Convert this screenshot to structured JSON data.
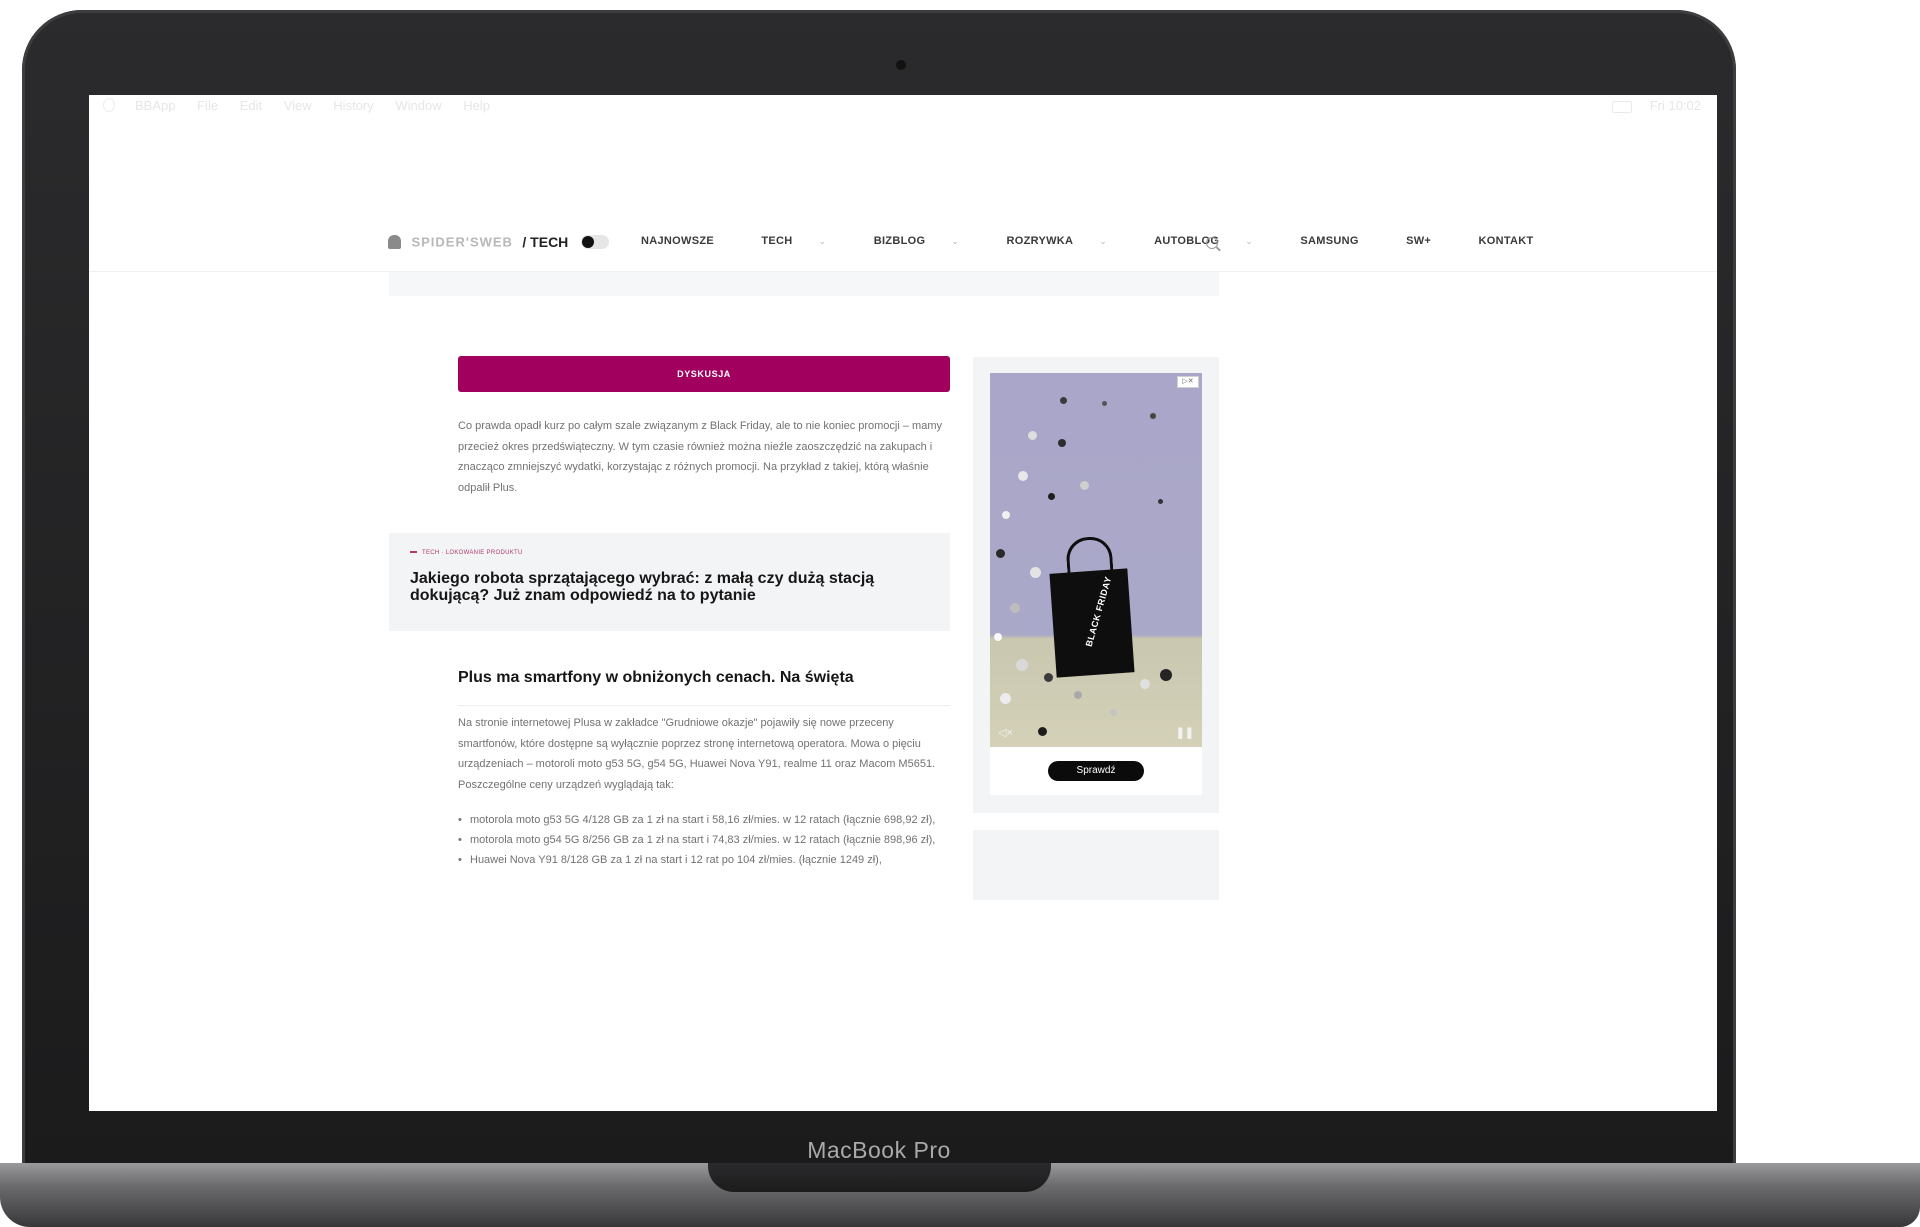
{
  "device": {
    "model_label": "MacBook Pro"
  },
  "menubar": {
    "items": [
      "BBApp",
      "File",
      "Edit",
      "View",
      "History",
      "Window",
      "Help"
    ],
    "clock": "Fri 10:02"
  },
  "site": {
    "logo_text": "SPIDER'SWEB",
    "section": "/ TECH",
    "nav": [
      {
        "label": "NAJNOWSZE",
        "caret": ""
      },
      {
        "label": "TECH",
        "caret": "⌄"
      },
      {
        "label": "BIZBLOG",
        "caret": "⌄"
      },
      {
        "label": "ROZRYWKA",
        "caret": "⌄"
      },
      {
        "label": "AUTOBLOG",
        "caret": "⌄"
      },
      {
        "label": "SAMSUNG",
        "caret": ""
      },
      {
        "label": "SW+",
        "caret": ""
      },
      {
        "label": "KONTAKT",
        "caret": ""
      }
    ]
  },
  "article": {
    "discuss_label": "DYSKUSJA",
    "intro": "Co prawda opadł kurz po całym szale związanym z Black Friday, ale to nie koniec promocji – mamy przecież okres przedświąteczny. W tym czasie również można nieźle zaoszczędzić na zakupach i znacząco zmniejszyć wydatki, korzystając z różnych promocji. Na przykład z takiej, którą właśnie odpalił Plus.",
    "related": {
      "category": "TECH · LOKOWANIE PRODUKTU",
      "title": "Jakiego robota sprzątającego wybrać: z małą czy dużą stacją dokującą? Już znam odpowiedź na to pytanie"
    },
    "heading": "Plus ma smartfony w obniżonych cenach. Na święta",
    "body": "Na stronie internetowej Plusa w zakładce \"Grudniowe okazje\" pojawiły się nowe przeceny smartfonów, które dostępne są wyłącznie poprzez stronę internetową operatora. Mowa o pięciu urządzeniach – motoroli moto g53 5G, g54 5G, Huawei Nova Y91, realme 11 oraz Macom M5651. Poszczególne ceny urządzeń wyglądają tak:",
    "bullets": [
      "motorola moto g53 5G 4/128 GB za 1 zł na start i 58,16 zł/mies. w 12 ratach (łącznie 698,92 zł),",
      "motorola moto g54 5G 8/256 GB za 1 zł na start i 74,83 zł/mies. w 12 ratach (łącznie 898,96 zł),",
      "Huawei Nova Y91 8/128 GB za 1 zł na start i 12 rat po 104 zł/mies. (łącznie 1249 zł),"
    ]
  },
  "ad": {
    "badge": "▷✕",
    "bag_text": "BLACK FRIDAY",
    "cta_label": "Sprawdź",
    "mute_icon": "speaker-muted-icon",
    "pause_icon": "pause-icon"
  },
  "colors": {
    "accent": "#a2005f",
    "panel": "#f3f4f6",
    "heading": "#161616",
    "body_text": "#727272"
  }
}
